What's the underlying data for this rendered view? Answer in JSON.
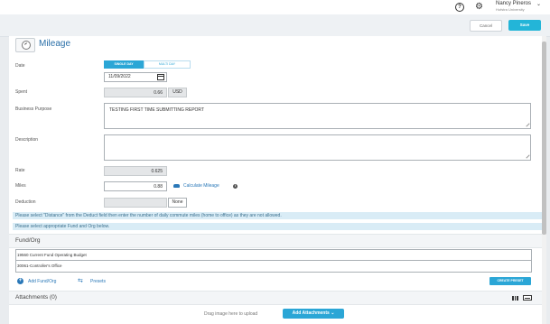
{
  "header": {
    "help_icon": "question-circle-icon",
    "settings_icon": "gear-icon",
    "user_name": "Nancy Pineros",
    "user_org": "Hofstra University",
    "user_caret": "⌄"
  },
  "actions": {
    "cancel_label": "Cancel",
    "save_label": "Save"
  },
  "page": {
    "title": "Mileage",
    "icon": "speedometer-icon"
  },
  "form": {
    "date": {
      "label": "Date",
      "mode_options": [
        "SINGLE DAY",
        "MULTI DAY"
      ],
      "selected_mode": "SINGLE DAY",
      "value": "11/09/2022"
    },
    "spent": {
      "label": "Spent",
      "value": "0.66",
      "currency": "USD"
    },
    "business_purpose": {
      "label": "Business Purpose",
      "value": "TESTING FIRST TIME SUBMITTING REPORT"
    },
    "description": {
      "label": "Description",
      "value": ""
    },
    "rate": {
      "label": "Rate",
      "value": "0.625"
    },
    "miles": {
      "label": "Miles",
      "value": "0.88",
      "calculate_link": "Calculate Mileage"
    },
    "deduction": {
      "label": "Deduction",
      "value": "",
      "select_value": "None"
    }
  },
  "notices": [
    "Please select \"Distance\" from the Deduct field then enter the number of daily commute miles (home to office) as they are not allowed.",
    "Please select appropriate Fund and Org below."
  ],
  "fund_org": {
    "title": "Fund/Org",
    "rows": [
      "19560 Current Fund Operating Budget",
      "30061-Controller's Office"
    ],
    "add_link": "Add Fund/Org",
    "presets_link": "Presets",
    "create_preset_label": "CREATE PRESET"
  },
  "attachments": {
    "title": "Attachments",
    "count": "(0)",
    "drag_text": "Drag image here to upload",
    "add_label": "Add Attachments ⌄"
  },
  "colors": {
    "accent": "#2ba6d6",
    "link": "#2a78b8",
    "notice_bg": "#d9ecf6"
  }
}
